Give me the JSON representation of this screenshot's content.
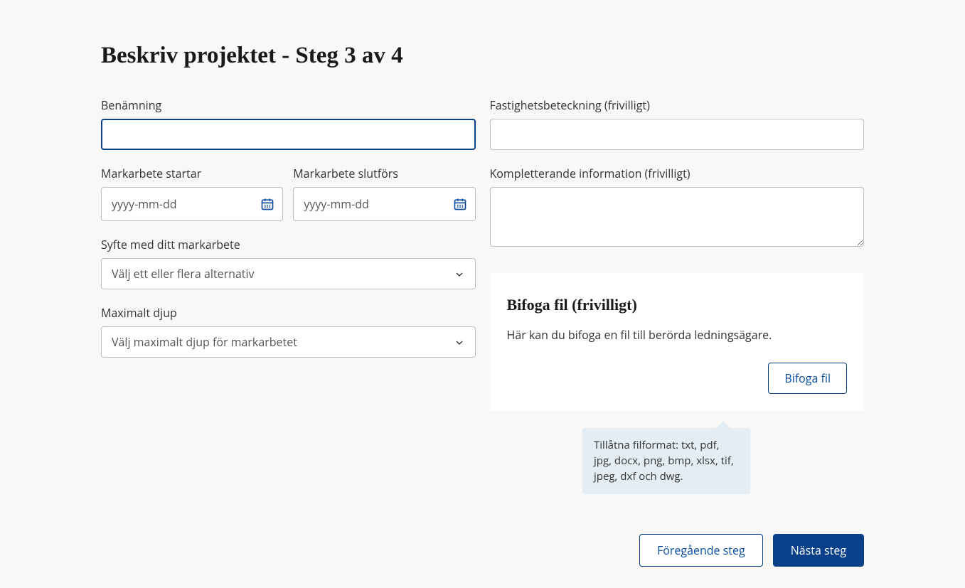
{
  "page": {
    "title": "Beskriv projektet - Steg 3 av 4"
  },
  "left": {
    "name_label": "Benämning",
    "name_value": "",
    "start_label": "Markarbete startar",
    "start_placeholder": "yyyy-mm-dd",
    "end_label": "Markarbete slutförs",
    "end_placeholder": "yyyy-mm-dd",
    "purpose_label": "Syfte med ditt markarbete",
    "purpose_placeholder": "Välj ett eller flera alternativ",
    "depth_label": "Maximalt djup",
    "depth_placeholder": "Välj maximalt djup för markarbetet"
  },
  "right": {
    "property_label": "Fastighetsbeteckning (frivilligt)",
    "property_value": "",
    "extra_label": "Kompletterande information (frivilligt)",
    "extra_value": ""
  },
  "attach": {
    "heading": "Bifoga fil (frivilligt)",
    "description": "Här kan du bifoga en fil till berörda ledningsägare.",
    "button": "Bifoga fil",
    "tooltip": "Tillåtna filformat: txt, pdf, jpg, docx, png, bmp, xlsx, tif, jpeg, dxf och dwg."
  },
  "footer": {
    "prev": "Föregående steg",
    "next": "Nästa steg"
  },
  "colors": {
    "primary": "#0a3f8a"
  }
}
